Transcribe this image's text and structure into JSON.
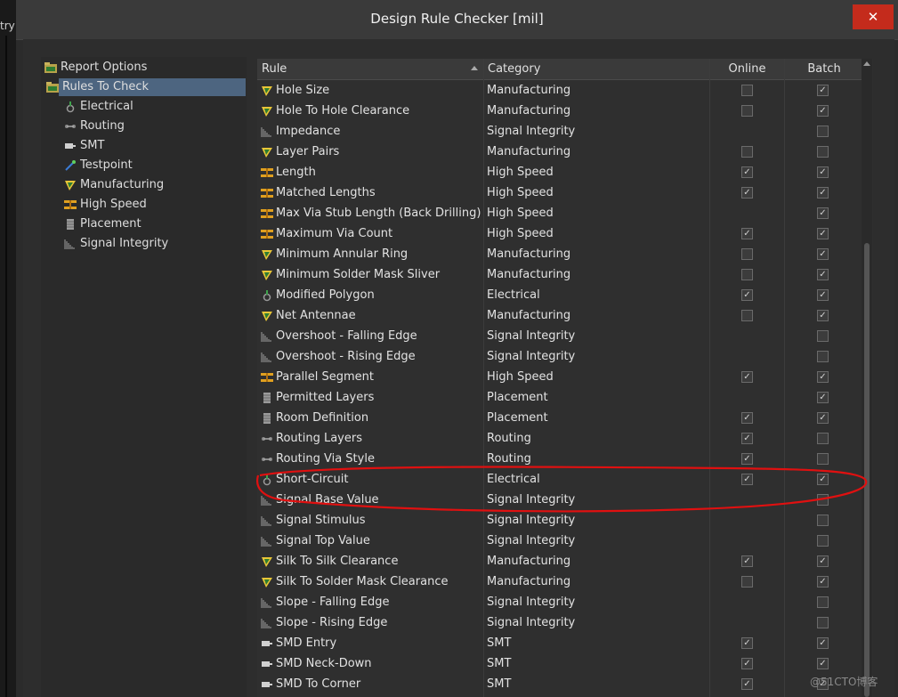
{
  "window": {
    "title": "Design Rule Checker [mil]",
    "close_label": "✕",
    "left_fragment": "try"
  },
  "tree": [
    {
      "label": "Report Options",
      "icon": "folder-icon",
      "level": 0,
      "selected": false
    },
    {
      "label": "Rules To Check",
      "icon": "folder-icon",
      "level": 0,
      "selected": true
    },
    {
      "label": "Electrical",
      "icon": "electrical-icon",
      "level": 1,
      "selected": false
    },
    {
      "label": "Routing",
      "icon": "routing-icon",
      "level": 1,
      "selected": false
    },
    {
      "label": "SMT",
      "icon": "smt-icon",
      "level": 1,
      "selected": false
    },
    {
      "label": "Testpoint",
      "icon": "testpoint-icon",
      "level": 1,
      "selected": false
    },
    {
      "label": "Manufacturing",
      "icon": "manufacturing-icon",
      "level": 1,
      "selected": false
    },
    {
      "label": "High Speed",
      "icon": "highspeed-icon",
      "level": 1,
      "selected": false
    },
    {
      "label": "Placement",
      "icon": "placement-icon",
      "level": 1,
      "selected": false
    },
    {
      "label": "Signal Integrity",
      "icon": "signal-integrity-icon",
      "level": 1,
      "selected": false
    }
  ],
  "columns": {
    "rule": "Rule",
    "category": "Category",
    "online": "Online",
    "batch": "Batch"
  },
  "rows": [
    {
      "rule": "Hole Size",
      "category": "Manufacturing",
      "icon": "manufacturing-icon",
      "online": false,
      "batch": true
    },
    {
      "rule": "Hole To Hole Clearance",
      "category": "Manufacturing",
      "icon": "manufacturing-icon",
      "online": false,
      "batch": true
    },
    {
      "rule": "Impedance",
      "category": "Signal Integrity",
      "icon": "signal-integrity-icon",
      "online": null,
      "batch": false
    },
    {
      "rule": "Layer Pairs",
      "category": "Manufacturing",
      "icon": "manufacturing-icon",
      "online": false,
      "batch": false
    },
    {
      "rule": "Length",
      "category": "High Speed",
      "icon": "highspeed-icon",
      "online": true,
      "batch": true
    },
    {
      "rule": "Matched Lengths",
      "category": "High Speed",
      "icon": "highspeed-icon",
      "online": true,
      "batch": true
    },
    {
      "rule": "Max Via Stub Length (Back Drilling)",
      "category": "High Speed",
      "icon": "highspeed-icon",
      "online": null,
      "batch": true
    },
    {
      "rule": "Maximum Via Count",
      "category": "High Speed",
      "icon": "highspeed-icon",
      "online": true,
      "batch": true
    },
    {
      "rule": "Minimum Annular Ring",
      "category": "Manufacturing",
      "icon": "manufacturing-icon",
      "online": false,
      "batch": true
    },
    {
      "rule": "Minimum Solder Mask Sliver",
      "category": "Manufacturing",
      "icon": "manufacturing-icon",
      "online": false,
      "batch": true
    },
    {
      "rule": "Modified Polygon",
      "category": "Electrical",
      "icon": "electrical-icon",
      "online": true,
      "batch": true
    },
    {
      "rule": "Net Antennae",
      "category": "Manufacturing",
      "icon": "manufacturing-icon",
      "online": false,
      "batch": true
    },
    {
      "rule": "Overshoot - Falling Edge",
      "category": "Signal Integrity",
      "icon": "signal-integrity-icon",
      "online": null,
      "batch": false
    },
    {
      "rule": "Overshoot - Rising Edge",
      "category": "Signal Integrity",
      "icon": "signal-integrity-icon",
      "online": null,
      "batch": false
    },
    {
      "rule": "Parallel Segment",
      "category": "High Speed",
      "icon": "highspeed-icon",
      "online": true,
      "batch": true
    },
    {
      "rule": "Permitted Layers",
      "category": "Placement",
      "icon": "placement-icon",
      "online": null,
      "batch": true
    },
    {
      "rule": "Room Definition",
      "category": "Placement",
      "icon": "placement-icon",
      "online": true,
      "batch": true
    },
    {
      "rule": "Routing Layers",
      "category": "Routing",
      "icon": "routing-icon",
      "online": true,
      "batch": false
    },
    {
      "rule": "Routing Via Style",
      "category": "Routing",
      "icon": "routing-icon",
      "online": true,
      "batch": false
    },
    {
      "rule": "Short-Circuit",
      "category": "Electrical",
      "icon": "electrical-icon",
      "online": true,
      "batch": true
    },
    {
      "rule": "Signal Base Value",
      "category": "Signal Integrity",
      "icon": "signal-integrity-icon",
      "online": null,
      "batch": false
    },
    {
      "rule": "Signal Stimulus",
      "category": "Signal Integrity",
      "icon": "signal-integrity-icon",
      "online": null,
      "batch": false
    },
    {
      "rule": "Signal Top Value",
      "category": "Signal Integrity",
      "icon": "signal-integrity-icon",
      "online": null,
      "batch": false
    },
    {
      "rule": "Silk To Silk Clearance",
      "category": "Manufacturing",
      "icon": "manufacturing-icon",
      "online": true,
      "batch": true
    },
    {
      "rule": "Silk To Solder Mask Clearance",
      "category": "Manufacturing",
      "icon": "manufacturing-icon",
      "online": false,
      "batch": true
    },
    {
      "rule": "Slope - Falling Edge",
      "category": "Signal Integrity",
      "icon": "signal-integrity-icon",
      "online": null,
      "batch": false
    },
    {
      "rule": "Slope - Rising Edge",
      "category": "Signal Integrity",
      "icon": "signal-integrity-icon",
      "online": null,
      "batch": false
    },
    {
      "rule": "SMD Entry",
      "category": "SMT",
      "icon": "smt-icon",
      "online": true,
      "batch": true
    },
    {
      "rule": "SMD Neck-Down",
      "category": "SMT",
      "icon": "smt-icon",
      "online": true,
      "batch": true
    },
    {
      "rule": "SMD To Corner",
      "category": "SMT",
      "icon": "smt-icon",
      "online": true,
      "batch": true
    }
  ],
  "watermark": "@51CTO博客",
  "colors": {
    "accent_selected": "#4d6580",
    "annotation": "#e01010",
    "close": "#c42b1c"
  }
}
